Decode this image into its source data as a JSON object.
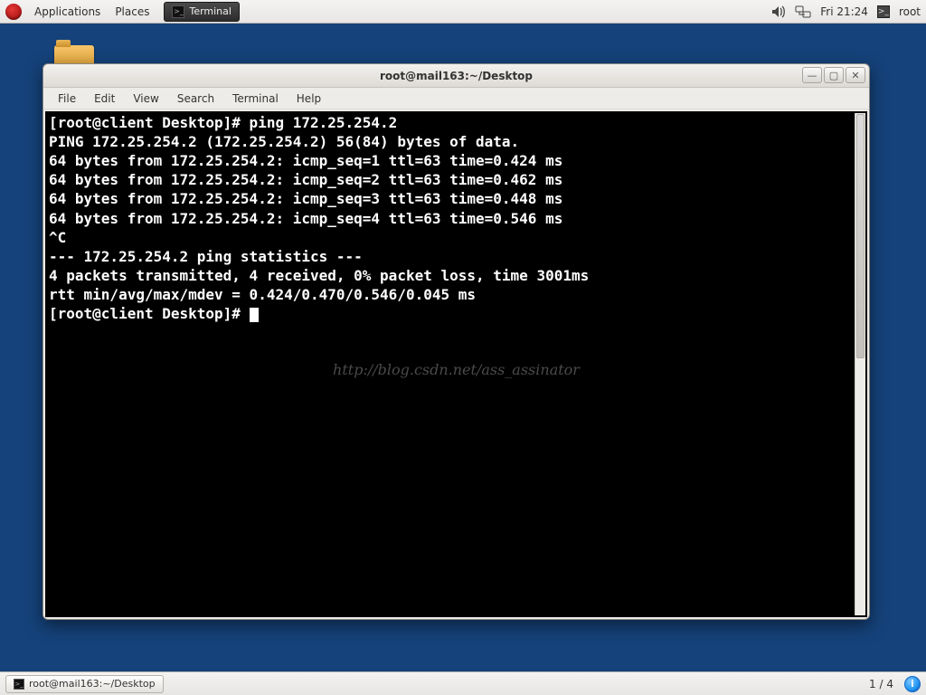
{
  "top_panel": {
    "applications": "Applications",
    "places": "Places",
    "running_app": "Terminal",
    "clock": "Fri 21:24",
    "user": "root"
  },
  "window": {
    "title": "root@mail163:~/Desktop",
    "menu": {
      "file": "File",
      "edit": "Edit",
      "view": "View",
      "search": "Search",
      "terminal": "Terminal",
      "help": "Help"
    }
  },
  "terminal": {
    "lines": [
      "[root@client Desktop]# ping 172.25.254.2",
      "PING 172.25.254.2 (172.25.254.2) 56(84) bytes of data.",
      "64 bytes from 172.25.254.2: icmp_seq=1 ttl=63 time=0.424 ms",
      "64 bytes from 172.25.254.2: icmp_seq=2 ttl=63 time=0.462 ms",
      "64 bytes from 172.25.254.2: icmp_seq=3 ttl=63 time=0.448 ms",
      "64 bytes from 172.25.254.2: icmp_seq=4 ttl=63 time=0.546 ms",
      "^C",
      "--- 172.25.254.2 ping statistics ---",
      "4 packets transmitted, 4 received, 0% packet loss, time 3001ms",
      "rtt min/avg/max/mdev = 0.424/0.470/0.546/0.045 ms"
    ],
    "prompt": "[root@client Desktop]# ",
    "watermark": "http://blog.csdn.net/ass_assinator"
  },
  "bottom_panel": {
    "task": "root@mail163:~/Desktop",
    "workspace": "1 / 4",
    "notify": "i"
  }
}
